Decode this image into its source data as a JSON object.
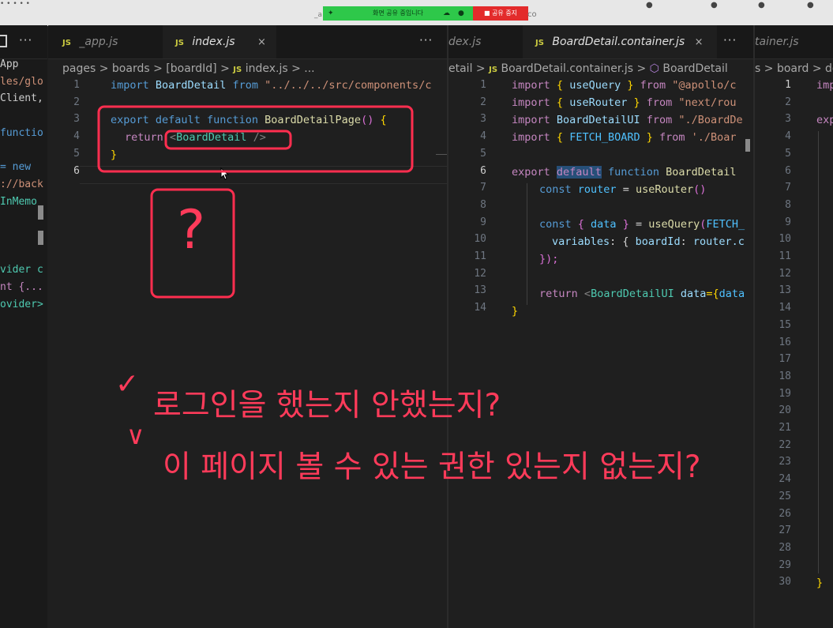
{
  "titlebar": {
    "left_fragment": "• • • • •",
    "mid_fragment": "_a",
    "right_fragment": "co",
    "share_bar": {
      "message": "화면 공유 중입니다"
    },
    "stop_share": {
      "label": "공유 중지"
    }
  },
  "sidebar": {
    "lines": [
      "App",
      "les/glo",
      "Client,",
      "",
      "functio",
      "",
      "= new",
      "://back",
      "InMemo",
      "",
      "",
      "",
      "vider c",
      "nt {...",
      "ovider>"
    ]
  },
  "left_group": {
    "tabs": [
      {
        "badge": "JS",
        "name": "_app.js"
      },
      {
        "badge": "JS",
        "name": "index.js",
        "close": "×"
      }
    ],
    "more": "···",
    "breadcrumb": {
      "p1": "pages",
      "p2": "boards",
      "p3": "[boardId]",
      "badge": "JS",
      "p4": "index.js",
      "p5": "..."
    },
    "sep": ">",
    "line_numbers": [
      "1",
      "2",
      "3",
      "4",
      "5",
      "6"
    ],
    "code": {
      "l1_kw": "import",
      "l1_id": "BoardDetail",
      "l1_from": "from",
      "l1_str": "\"../../../src/components/c",
      "l3_kw1": "export",
      "l3_kw2": "default",
      "l3_kw3": "function",
      "l3_fn": "BoardDetailPage",
      "l3_paren": "()",
      "l3_brace": "{",
      "l4_kw": "return",
      "l4_lt": "<",
      "l4_tag": "BoardDetail",
      "l4_end": " />",
      "l5_brace": "}"
    }
  },
  "middle_group": {
    "tabs": [
      {
        "name": "dex.js"
      },
      {
        "badge": "JS",
        "name": "BoardDetail.container.js",
        "close": "×"
      }
    ],
    "more": "···",
    "breadcrumb": {
      "p1": "etail",
      "p2": "BoardDetail.container.js",
      "p3": "BoardDetail"
    },
    "line_numbers": [
      "1",
      "2",
      "3",
      "4",
      "5",
      "6",
      "7",
      "8",
      "9",
      "10",
      "11",
      "12",
      "13",
      "14"
    ],
    "code": {
      "l1": {
        "kw": "import",
        "o": "{ ",
        "id": "useQuery",
        "c": " }",
        "from": "from",
        "str": "\"@apollo/c"
      },
      "l2": {
        "kw": "import",
        "o": "{ ",
        "id": "useRouter",
        "c": " }",
        "from": "from",
        "str": "\"next/rou"
      },
      "l3": {
        "kw": "import",
        "id": "BoardDetailUI",
        "from": "from",
        "str": "\"./BoardDe"
      },
      "l4": {
        "kw": "import",
        "o": "{ ",
        "id": "FETCH_BOARD",
        "c": " }",
        "from": "from",
        "str": "'./Boar"
      },
      "l6": {
        "kw1": "export",
        "kw2": "default",
        "kw3": "function",
        "fn": "BoardDetail"
      },
      "l7": {
        "kw": "const",
        "var": "router",
        "eq": " = ",
        "fn": "useRouter",
        "paren": "()"
      },
      "l9": {
        "kw": "const",
        "o": "{ ",
        "var": "data",
        "c": " }",
        "eq": " = ",
        "fn": "useQuery",
        "p": "(",
        "arg": "FETCH_"
      },
      "l10": {
        "key": "variables",
        "rest": ": { ",
        "key2": "boardId",
        "colon": ": ",
        "var": "router.c"
      },
      "l11": {
        "text": "});"
      },
      "l13": {
        "kw": "return",
        "lt": "<",
        "tag": "BoardDetailUI",
        "attr": "data",
        "eq": "={",
        "val": "data"
      },
      "l14": {
        "brace": "}"
      }
    }
  },
  "right_group": {
    "tabs": [
      {
        "name": "tainer.js"
      }
    ],
    "breadcrumb": {
      "p1": "s",
      "p2": "board",
      "p3": "de"
    },
    "line_numbers": [
      "1",
      "2",
      "3",
      "4",
      "5",
      "6",
      "7",
      "8",
      "9",
      "10",
      "11",
      "12",
      "13",
      "14",
      "15",
      "16",
      "17",
      "18",
      "19",
      "20",
      "21",
      "22",
      "23",
      "24",
      "25",
      "26",
      "27",
      "28",
      "29",
      "30"
    ],
    "code": {
      "l1": "imp",
      "l3": "exp",
      "l30": "}"
    }
  },
  "annotations": {
    "question": "?",
    "check1": "✓",
    "text1": "로그인을 했는지 안했는지?",
    "check2": "∨",
    "text2": "이 페이지 볼 수 있는 권한 있는지 없는지?",
    "color": "#ff3b5a"
  }
}
